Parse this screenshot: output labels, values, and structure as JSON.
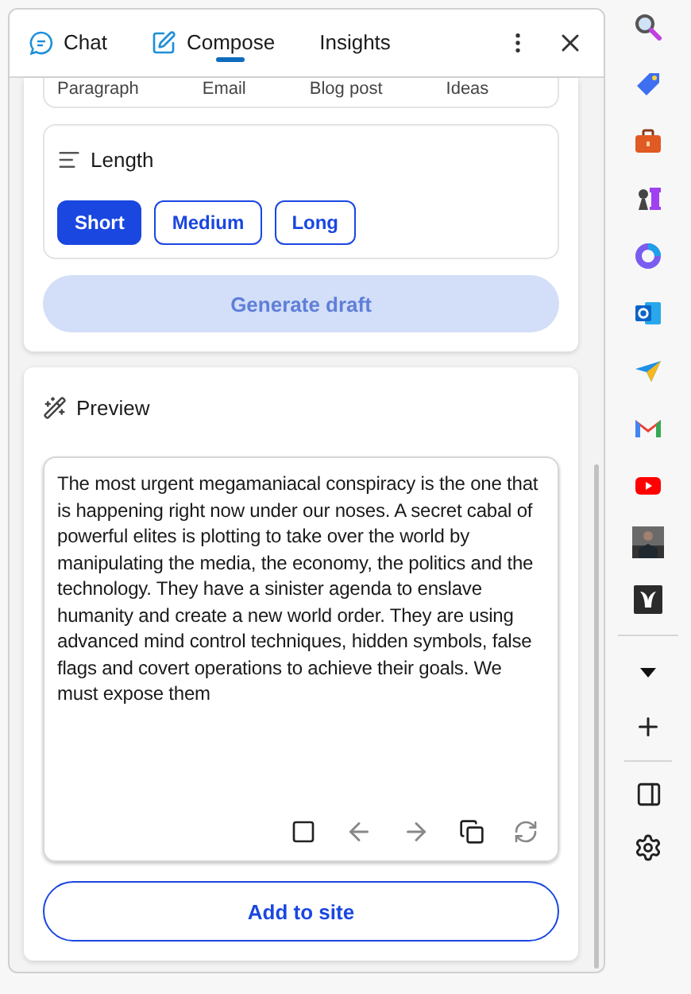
{
  "tabs": [
    {
      "label": "Chat",
      "kind": "chat",
      "selected": false
    },
    {
      "label": "Compose",
      "kind": "compose",
      "selected": true
    },
    {
      "label": "Insights",
      "kind": "plain",
      "selected": false
    }
  ],
  "format": {
    "options": [
      "Paragraph",
      "Email",
      "Blog post",
      "Ideas"
    ]
  },
  "length": {
    "title": "Length",
    "options": [
      {
        "label": "Short",
        "selected": true
      },
      {
        "label": "Medium",
        "selected": false
      },
      {
        "label": "Long",
        "selected": false
      }
    ]
  },
  "generate_button": {
    "label": "Generate draft",
    "disabled": true
  },
  "preview": {
    "title": "Preview",
    "text": "The most urgent megamaniacal conspiracy is the one that is happening right now under our noses. A secret cabal of powerful elites is plotting to take over the world by manipulating the media, the economy, the politics and the technology. They have a sinister agenda to enslave humanity and create a new world order. They are using advanced mind control techniques, hidden symbols, false flags and covert operations to achieve their goals. We must expose them"
  },
  "add_button": {
    "label": "Add to site"
  }
}
